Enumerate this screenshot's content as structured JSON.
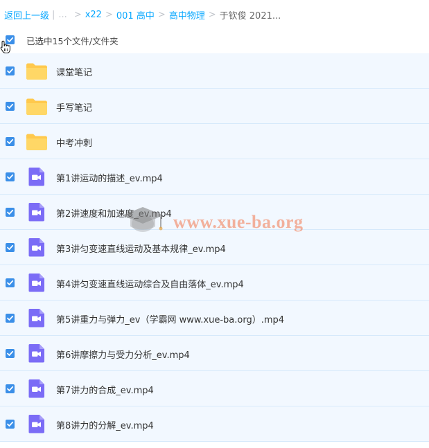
{
  "breadcrumb": {
    "back": "返回上一级",
    "ellipsis": "...",
    "items": [
      "x22",
      "001 高中",
      "高中物理"
    ],
    "current": "于钦俊 2021..."
  },
  "selection": {
    "status_text": "已选中15个文件/文件夹"
  },
  "files": [
    {
      "name": "课堂笔记",
      "type": "folder"
    },
    {
      "name": "手写笔记",
      "type": "folder"
    },
    {
      "name": "中考冲刺",
      "type": "folder"
    },
    {
      "name": "第1讲运动的描述_ev.mp4",
      "type": "video"
    },
    {
      "name": "第2讲速度和加速度_ev.mp4",
      "type": "video"
    },
    {
      "name": "第3讲匀变速直线运动及基本规律_ev.mp4",
      "type": "video"
    },
    {
      "name": "第4讲匀变速直线运动综合及自由落体_ev.mp4",
      "type": "video"
    },
    {
      "name": "第5讲重力与弹力_ev（学霸网 www.xue-ba.org）.mp4",
      "type": "video"
    },
    {
      "name": "第6讲摩擦力与受力分析_ev.mp4",
      "type": "video"
    },
    {
      "name": "第7讲力的合成_ev.mp4",
      "type": "video"
    },
    {
      "name": "第8讲力的分解_ev.mp4",
      "type": "video"
    }
  ],
  "watermark": {
    "text": "www.xue-ba.org"
  },
  "colors": {
    "link": "#06a7ff",
    "checkbox": "#3b8fe8",
    "row_selected_bg": "#f2f8ff",
    "row_border": "#d6e9fb",
    "folder": "#ffc94d",
    "video": "#7b6cf6"
  },
  "icons": {
    "folder": "folder-icon",
    "video": "video-file-icon",
    "check": "check-icon",
    "cursor": "hand-cursor-icon"
  }
}
